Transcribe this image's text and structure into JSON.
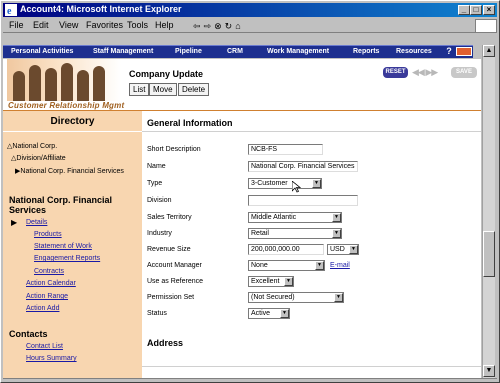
{
  "window": {
    "title": "Account4: Microsoft Internet Explorer"
  },
  "menu": [
    "File",
    "Edit",
    "View",
    "Favorites",
    "Tools",
    "Help"
  ],
  "toolbar": {
    "back": "⇦",
    "forward": "⇨",
    "stop": "⊗",
    "refresh": "↻",
    "home": "⌂"
  },
  "nav": {
    "items": [
      "Personal Activities",
      "Staff Management",
      "Pipeline",
      "CRM",
      "Work Management",
      "Reports",
      "Resources"
    ],
    "help": "?"
  },
  "header": {
    "brand": "Customer Relationship Mgmt",
    "title": "Company Update",
    "buttons": [
      "List",
      "Move",
      "Delete"
    ],
    "reset": "RESET",
    "arrows": "◀◀ ▶▶",
    "save": "SAVE"
  },
  "sidebar": {
    "directory_title": "Directory",
    "tree": [
      "National Corp.",
      "Division/Affiliate",
      "National Corp. Financial Services"
    ],
    "company_title": "National Corp. Financial Services",
    "links": [
      "Details",
      "Products",
      "Statement of Work",
      "Engagement Reports",
      "Contracts",
      "Action Calendar",
      "Action Range",
      "Action Add"
    ],
    "contacts_title": "Contacts",
    "contact_links": [
      "Contact List",
      "Hours Summary"
    ]
  },
  "form": {
    "section_title": "General Information",
    "address_title": "Address",
    "fields": [
      {
        "label": "Short Description",
        "value": "NCB-FS"
      },
      {
        "label": "Name",
        "value": "National Corp. Financial Services"
      },
      {
        "label": "Type",
        "value": "3-Customer"
      },
      {
        "label": "Division",
        "value": ""
      },
      {
        "label": "Sales Territory",
        "value": "Middle Atlantic"
      },
      {
        "label": "Industry",
        "value": "Retail"
      },
      {
        "label": "Revenue Size",
        "value": "200,000,000.00",
        "currency": "USD"
      },
      {
        "label": "Account Manager",
        "value": "None",
        "link": "E-mail"
      },
      {
        "label": "Use as Reference",
        "value": "Excellent"
      },
      {
        "label": "Permission Set",
        "value": "(Not Secured)"
      },
      {
        "label": "Status",
        "value": "Active"
      }
    ]
  },
  "colors": {
    "titlebar": "#000080",
    "navbar": "#1d2f8f",
    "sidebar": "#f8d6b0",
    "link": "#1a1aa6"
  }
}
